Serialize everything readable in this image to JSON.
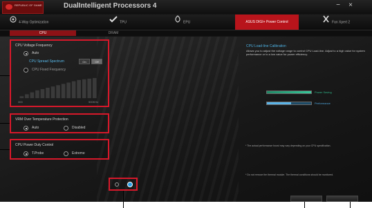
{
  "window": {
    "logo_text": "REPUBLIC OF GAMERS",
    "title": "DualIntelligent Processors 4",
    "minimize_label": "−",
    "close_label": "×"
  },
  "tabs": [
    {
      "label": "4-Way Optimization"
    },
    {
      "label": "TPU"
    },
    {
      "label": "EPU"
    },
    {
      "label": "ASUS DIGI+ Power Control"
    },
    {
      "label": "Fan Xpert 2"
    }
  ],
  "subtabs": [
    {
      "label": "CPU"
    },
    {
      "label": "DRAM"
    }
  ],
  "voltage_frequency": {
    "title": "CPU Voltage Frequency",
    "auto_label": "Auto",
    "spread_label": "CPU Spread Spectrum",
    "spread_options": [
      "On",
      "Off"
    ],
    "fixed_label": "CPU Fixed Frequency",
    "graph_min": "300",
    "graph_max": "500KHz"
  },
  "thermal": {
    "title": "VRM Over Temperature Protection",
    "options": [
      "Auto",
      "Disabled"
    ]
  },
  "duty": {
    "title": "CPU Power Duty Control",
    "options": [
      "T.Probe",
      "Extreme"
    ]
  },
  "description": {
    "title": "CPU Load-line Calibration",
    "text": "Allows you to adjust the voltage range to control CPU Load-line. Adjust to a high value for system performance or to a low value for power efficiency.",
    "power_saving_label": "Power Saving",
    "performance_label": "Performance",
    "note1": "* The actual performance boost may vary depending on your CPU specification.",
    "note2": "* Do not remove the thermal module. The thermal conditions should be monitored."
  },
  "colors": {
    "accent": "#b8141b",
    "highlight": "#d8182a",
    "info": "#4fb4e6",
    "power_saving": "#2fb88a",
    "performance": "#4fa8e0"
  },
  "pagination": {
    "total_pages": 2,
    "current_page": 2
  }
}
